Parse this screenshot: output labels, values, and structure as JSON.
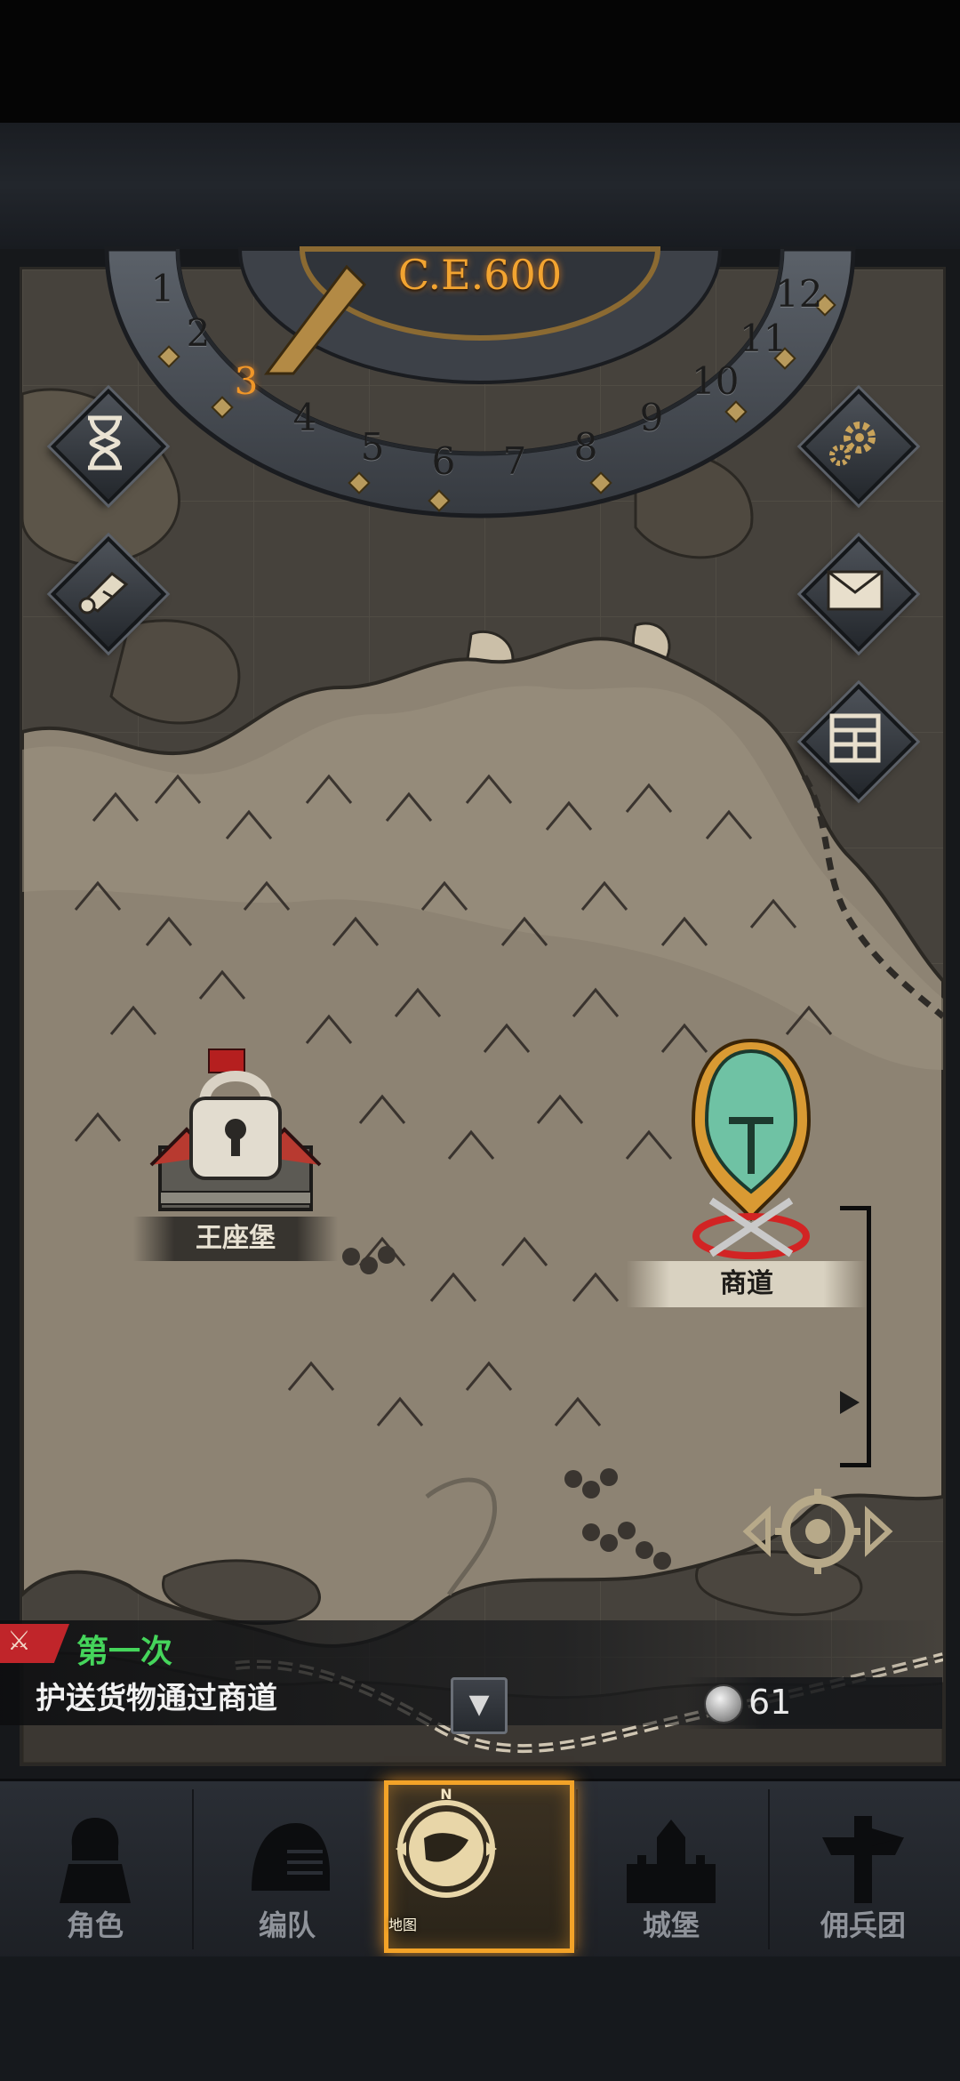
{
  "calendar": {
    "era": "C.E.600",
    "months": [
      "1",
      "2",
      "3",
      "4",
      "5",
      "6",
      "7",
      "8",
      "9",
      "10",
      "11",
      "12"
    ],
    "current_month": "3"
  },
  "side_buttons": {
    "left": [
      {
        "name": "hourglass-icon"
      },
      {
        "name": "scroll-icon"
      }
    ],
    "right": [
      {
        "name": "gear-icon"
      },
      {
        "name": "mail-icon"
      },
      {
        "name": "window-icon"
      }
    ]
  },
  "map": {
    "locations": [
      {
        "name": "castle",
        "label": "王座堡",
        "locked": true
      },
      {
        "name": "trade-route",
        "label": "商道",
        "selected": true
      }
    ]
  },
  "quest": {
    "title": "第一次",
    "description": "护送货物通过商道",
    "badge_color": "#c0252a",
    "title_color": "#45d55b"
  },
  "currency": {
    "icon": "silver-coin-icon",
    "amount": "61"
  },
  "nav": {
    "items": [
      {
        "label": "角色",
        "icon": "knight-icon"
      },
      {
        "label": "编队",
        "icon": "helmet-icon"
      },
      {
        "label": "地图",
        "icon": "map-compass-icon",
        "active": true,
        "compass_mark": "N"
      },
      {
        "label": "城堡",
        "icon": "castle-icon"
      },
      {
        "label": "佣兵团",
        "icon": "banner-icon"
      }
    ],
    "active_color": "#f3a328"
  }
}
